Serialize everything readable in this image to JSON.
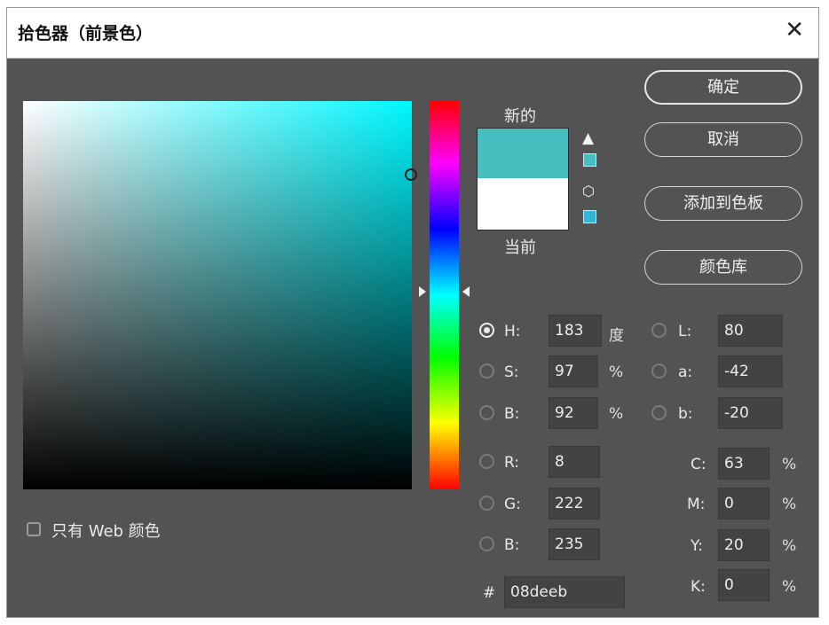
{
  "window": {
    "title": "拾色器（前景色）",
    "close_glyph": "✕"
  },
  "colors": {
    "new": "#08deeb",
    "new_display": "#47bfc0",
    "current": "#ffffff",
    "hue_pure": "#00f7ff",
    "field_top_right": "#4dc7c7"
  },
  "swatch_labels": {
    "new": "新的",
    "current": "当前"
  },
  "icons": {
    "gamut_warning": "warning-triangle-icon",
    "web_safe": "cube-icon"
  },
  "buttons": {
    "ok": "确定",
    "cancel": "取消",
    "add_to_swatches": "添加到色板",
    "color_libraries": "颜色库"
  },
  "hsb": {
    "selected": "H",
    "H": {
      "label": "H:",
      "value": "183",
      "unit": "度"
    },
    "S": {
      "label": "S:",
      "value": "97",
      "unit": "%"
    },
    "B": {
      "label": "B:",
      "value": "92",
      "unit": "%"
    }
  },
  "lab": {
    "L": {
      "label": "L:",
      "value": "80"
    },
    "a": {
      "label": "a:",
      "value": "-42"
    },
    "b": {
      "label": "b:",
      "value": "-20"
    }
  },
  "rgb": {
    "R": {
      "label": "R:",
      "value": "8"
    },
    "G": {
      "label": "G:",
      "value": "222"
    },
    "B": {
      "label": "B:",
      "value": "235"
    }
  },
  "cmyk": {
    "C": {
      "label": "C:",
      "value": "63",
      "unit": "%"
    },
    "M": {
      "label": "M:",
      "value": "0",
      "unit": "%"
    },
    "Y": {
      "label": "Y:",
      "value": "20",
      "unit": "%"
    },
    "K": {
      "label": "K:",
      "value": "0",
      "unit": "%"
    }
  },
  "hex": {
    "label": "#",
    "value": "08deeb"
  },
  "web_only": {
    "label": "只有 Web 颜色",
    "checked": false
  },
  "hue_slider_value_deg": 183
}
